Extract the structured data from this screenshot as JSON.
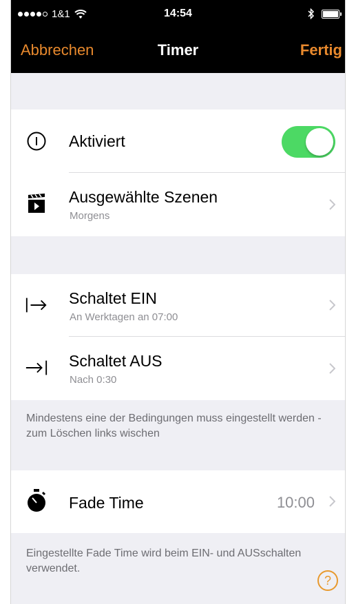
{
  "status_bar": {
    "carrier": "1&1",
    "signal_dots": 4,
    "time": "14:54",
    "icons": [
      "wifi-icon",
      "bluetooth-icon",
      "battery-icon"
    ]
  },
  "nav": {
    "cancel_label": "Abbrechen",
    "title": "Timer",
    "done_label": "Fertig"
  },
  "settings": {
    "activated": {
      "label": "Aktiviert",
      "toggle_on": true
    },
    "scenes": {
      "label": "Ausgewählte Szenen",
      "subtitle": "Morgens"
    },
    "on": {
      "label": "Schaltet EIN",
      "subtitle": "An Werktagen an  07:00"
    },
    "off": {
      "label": "Schaltet AUS",
      "subtitle": "Nach 0:30"
    },
    "conditions_footer": "Mindestens eine der Bedingungen muss eingestellt werden - zum Löschen links wischen",
    "fade": {
      "label": "Fade Time",
      "value": "10:00"
    },
    "fade_footer": "Eingestellte Fade Time wird beim EIN- und AUSschalten verwendet.",
    "help_symbol": "?"
  },
  "colors": {
    "accent": "#e8892d",
    "toggle_on": "#4cd964",
    "background": "#efeff4"
  }
}
